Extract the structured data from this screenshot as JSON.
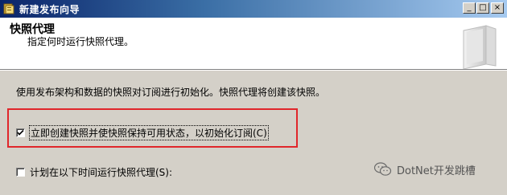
{
  "window": {
    "title": "新建发布向导",
    "minimize_label": "_",
    "maximize_label": "□",
    "close_label": "×"
  },
  "header": {
    "title": "快照代理",
    "subtitle": "指定何时运行快照代理。"
  },
  "main": {
    "description": "使用发布架构和数据的快照对订阅进行初始化。快照代理将创建该快照。",
    "option_immediate": {
      "label": "立即创建快照并使快照保持可用状态，以初始化订阅(C)",
      "checked": true
    },
    "option_schedule": {
      "label": "计划在以下时间运行快照代理(S):",
      "checked": false
    }
  },
  "watermark": {
    "text": "DotNet开发跳槽",
    "icon": "wechat-icon"
  },
  "colors": {
    "highlight_border": "#e0262b",
    "titlebar_start": "#0a246a",
    "titlebar_end": "#a6caf0"
  }
}
